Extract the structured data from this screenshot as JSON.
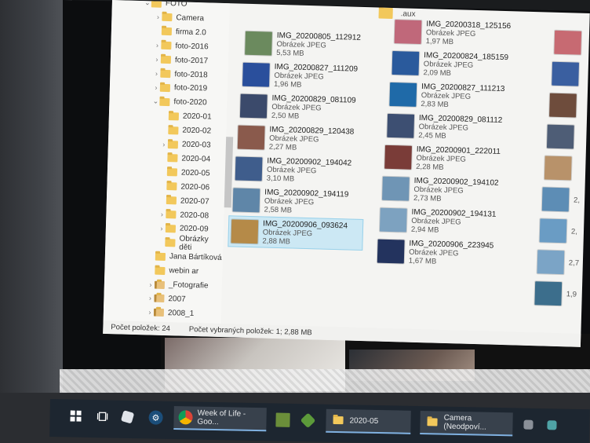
{
  "window": {
    "nav_items": [
      {
        "label": "FOTO",
        "level": 0,
        "expander": "expanded"
      },
      {
        "label": "Camera",
        "level": 1,
        "expander": "collapsed"
      },
      {
        "label": "firma 2.0",
        "level": 1,
        "expander": "none"
      },
      {
        "label": "foto-2016",
        "level": 1,
        "expander": "collapsed"
      },
      {
        "label": "foto-2017",
        "level": 1,
        "expander": "collapsed"
      },
      {
        "label": "foto-2018",
        "level": 1,
        "expander": "collapsed"
      },
      {
        "label": "foto-2019",
        "level": 1,
        "expander": "collapsed"
      },
      {
        "label": "foto-2020",
        "level": 1,
        "expander": "expanded"
      },
      {
        "label": "2020-01",
        "level": 2,
        "expander": "none"
      },
      {
        "label": "2020-02",
        "level": 2,
        "expander": "none"
      },
      {
        "label": "2020-03",
        "level": 2,
        "expander": "collapsed"
      },
      {
        "label": "2020-04",
        "level": 2,
        "expander": "none"
      },
      {
        "label": "2020-05",
        "level": 2,
        "expander": "none"
      },
      {
        "label": "2020-06",
        "level": 2,
        "expander": "none"
      },
      {
        "label": "2020-07",
        "level": 2,
        "expander": "none"
      },
      {
        "label": "2020-08",
        "level": 2,
        "expander": "collapsed"
      },
      {
        "label": "2020-09",
        "level": 2,
        "expander": "collapsed"
      },
      {
        "label": "Obrázky děti",
        "level": 2,
        "expander": "none"
      },
      {
        "label": "Jana Bártíková",
        "level": 1,
        "expander": "none"
      },
      {
        "label": "webin ar",
        "level": 1,
        "expander": "none"
      },
      {
        "label": "_Fotografie",
        "level": 1,
        "expander": "collapsed",
        "zip": true
      },
      {
        "label": "2007",
        "level": 1,
        "expander": "collapsed",
        "zip": true
      },
      {
        "label": "2008_1",
        "level": 1,
        "expander": "collapsed",
        "zip": true
      }
    ],
    "aux_folder": ".aux",
    "files_col1": [
      {
        "name": "IMG_20200805_112912",
        "type": "Obrázek JPEG",
        "size": "5,53 MB",
        "thumb": "#6b8a5e"
      },
      {
        "name": "IMG_20200827_111209",
        "type": "Obrázek JPEG",
        "size": "1,96 MB",
        "thumb": "#2a4f9c"
      },
      {
        "name": "IMG_20200829_081109",
        "type": "Obrázek JPEG",
        "size": "2,50 MB",
        "thumb": "#3b4a6b"
      },
      {
        "name": "IMG_20200829_120438",
        "type": "Obrázek JPEG",
        "size": "2,27 MB",
        "thumb": "#8a5a4c"
      },
      {
        "name": "IMG_20200902_194042",
        "type": "Obrázek JPEG",
        "size": "3,10 MB",
        "thumb": "#3f5d8c"
      },
      {
        "name": "IMG_20200902_194119",
        "type": "Obrázek JPEG",
        "size": "2,58 MB",
        "thumb": "#5f86a8"
      },
      {
        "name": "IMG_20200906_093624",
        "type": "Obrázek JPEG",
        "size": "2,88 MB",
        "thumb": "#b58a48"
      }
    ],
    "files_col2": [
      {
        "name": "IMG_20200318_125156",
        "type": "Obrázek JPEG",
        "size": "1,97 MB",
        "thumb": "#c0687a"
      },
      {
        "name": "IMG_20200824_185159",
        "type": "Obrázek JPEG",
        "size": "2,09 MB",
        "thumb": "#2a5a9c"
      },
      {
        "name": "IMG_20200827_111213",
        "type": "Obrázek JPEG",
        "size": "2,83 MB",
        "thumb": "#1f6aa8"
      },
      {
        "name": "IMG_20200829_081112",
        "type": "Obrázek JPEG",
        "size": "2,45 MB",
        "thumb": "#3d4f72"
      },
      {
        "name": "IMG_20200901_222011",
        "type": "Obrázek JPEG",
        "size": "2,28 MB",
        "thumb": "#7a3c38"
      },
      {
        "name": "IMG_20200902_194102",
        "type": "Obrázek JPEG",
        "size": "2,73 MB",
        "thumb": "#6f95b5"
      },
      {
        "name": "IMG_20200902_194131",
        "type": "Obrázek JPEG",
        "size": "2,94 MB",
        "thumb": "#7da2c0"
      },
      {
        "name": "IMG_20200906_223945",
        "type": "Obrázek JPEG",
        "size": "1,67 MB",
        "thumb": "#23335e"
      }
    ],
    "files_col3_sizes": [
      {
        "size": "",
        "thumb": "#c76a72"
      },
      {
        "size": "",
        "thumb": "#3a5fa0"
      },
      {
        "size": "",
        "thumb": "#6e4c3c"
      },
      {
        "size": "",
        "thumb": "#4e5d76"
      },
      {
        "size": "",
        "thumb": "#b8926a"
      },
      {
        "size": "2,",
        "thumb": "#5d8db5"
      },
      {
        "size": "2,",
        "thumb": "#6a9cc4"
      },
      {
        "size": "2,7",
        "thumb": "#7ba4c6"
      },
      {
        "size": "1,9",
        "thumb": "#3c6e8c"
      }
    ],
    "status": {
      "item_count": "Počet položek: 24",
      "selected": "Počet vybraných položek: 1; 2,88 MB"
    }
  },
  "taskbar": {
    "chrome_label": "Week of Life - Goo...",
    "folder_label": "2020-05",
    "camera_label": "Camera (Neodpoví..."
  }
}
